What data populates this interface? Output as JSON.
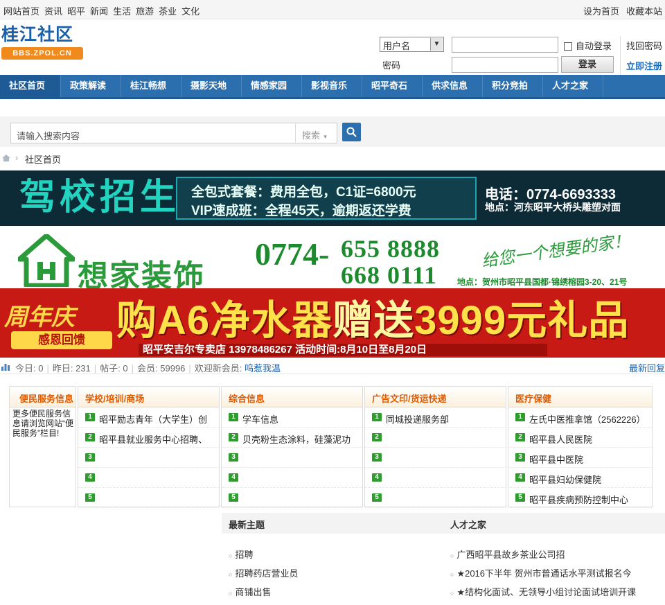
{
  "topbar": {
    "links": [
      "网站首页",
      "资讯",
      "昭平",
      "新闻",
      "生活",
      "旅游",
      "茶业",
      "文化"
    ],
    "set_home": "设为首页",
    "bookmark": "收藏本站"
  },
  "logo": {
    "title": "桂江社区",
    "domain": "BBS.ZPOL.CN"
  },
  "login": {
    "username_select": "用户名",
    "password_label": "密码",
    "auto_login": "自动登录",
    "find_password": "找回密码",
    "login_button": "登录",
    "register": "立即注册"
  },
  "nav": {
    "items": [
      "社区首页",
      "政策解读",
      "桂江畅想",
      "摄影天地",
      "情感家园",
      "影视音乐",
      "昭平奇石",
      "供求信息",
      "积分竞拍",
      "人才之家"
    ],
    "active": 0
  },
  "search": {
    "placeholder": "请输入搜索内容",
    "type_label": "搜索"
  },
  "breadcrumb": {
    "current": "社区首页"
  },
  "ads": {
    "driving": {
      "headline": "驾校招生",
      "line1": "全包式套餐：费用全包，C1证=6800元",
      "line2": "VIP速成班：全程45天，逾期返还学费",
      "phone": "电话：0774-6693333",
      "address": "地点：河东昭平大桥头雕塑对面"
    },
    "decor": {
      "brand": "想家装饰",
      "area_code": "0774-",
      "phone1": "655 8888",
      "phone2": "668 0111",
      "slogan": "给您一个想要的家！",
      "address": "地点：贺州市昭平县国都·锦绣榕园3-20、21号"
    },
    "purifier": {
      "badge": "周年庆",
      "badge_sub": "感恩回馈",
      "headline_a": "购A6净水器",
      "headline_b": "赠送",
      "headline_c": "3999元礼品",
      "store": "昭平安吉尔专卖店 13978486267  活动时间:8月10日至8月20日"
    }
  },
  "stats": {
    "today": "今日: 0",
    "yesterday": "昨日: 231",
    "posts": "帖子: 0",
    "members": "会员: 59996",
    "welcome": "欢迎新会员:",
    "new_member": "呜惹我温",
    "latest_reply": "最新回复"
  },
  "service": {
    "title": "便民服务信息",
    "notice": "更多便民服务信息请浏览网站“便民服务”栏目!",
    "columns": [
      {
        "title": "学校/培训/商场",
        "items": [
          "昭平励志青年（大学生）创",
          "昭平县就业服务中心招聘、",
          "",
          "",
          ""
        ]
      },
      {
        "title": "综合信息",
        "items": [
          "学车信息",
          "贝壳粉生态涂料，硅藻泥功",
          "",
          "",
          ""
        ]
      },
      {
        "title": "广告文印/货运快递",
        "items": [
          "同城投递服务部",
          "",
          "",
          "",
          ""
        ]
      },
      {
        "title": "医疗保健",
        "items": [
          "左氏中医推拿馆（2562226）",
          "昭平县人民医院",
          "昭平县中医院",
          "昭平县妇幼保健院",
          "昭平县疾病预防控制中心"
        ]
      }
    ],
    "numbers": [
      "1",
      "2",
      "3",
      "4",
      "5"
    ]
  },
  "latest_topics": {
    "title": "最新主题",
    "items": [
      "招聘",
      "招聘药店营业员",
      "商铺出售"
    ]
  },
  "talent": {
    "title": "人才之家",
    "items": [
      "广西昭平县故乡茶业公司招",
      "★2016下半年 贺州市普通话水平测试报名今",
      "★结构化面试、无领导小组讨论面试培训开课"
    ]
  },
  "colors": {
    "nav_blue": "#2b6fae",
    "orange_head": "#e05a00",
    "num_green": "#2e9d2e",
    "ad_red": "#c81a14"
  }
}
